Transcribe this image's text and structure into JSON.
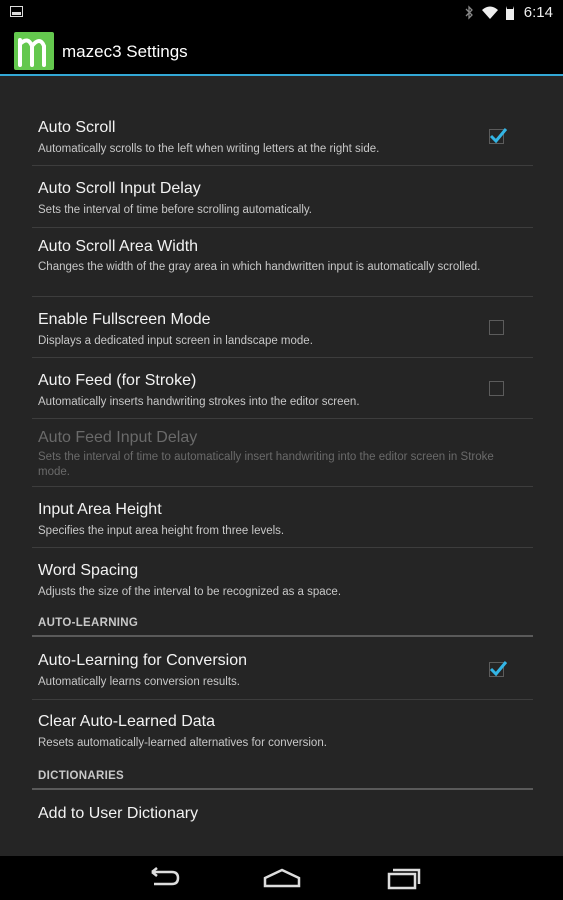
{
  "status_bar": {
    "time": "6:14"
  },
  "action_bar": {
    "title": "mazec3 Settings"
  },
  "items": [
    {
      "title": "Auto Scroll",
      "summary": "Automatically scrolls to the left when writing letters at the right side.",
      "checked": true
    },
    {
      "title": "Auto Scroll Input Delay",
      "summary": "Sets the interval of time before scrolling automatically."
    },
    {
      "title": "Auto Scroll Area Width",
      "summary": "Changes the width of the gray area in which handwritten input is automatically scrolled."
    },
    {
      "title": "Enable Fullscreen Mode",
      "summary": "Displays a dedicated input screen in landscape mode.",
      "checked": false
    },
    {
      "title": "Auto Feed (for Stroke)",
      "summary": "Automatically inserts handwriting strokes into the editor screen.",
      "checked": false
    },
    {
      "title": "Auto Feed Input Delay",
      "summary": "Sets the interval of time to automatically insert handwriting into the editor screen in Stroke mode.",
      "enabled": false
    },
    {
      "title": "Input Area Height",
      "summary": "Specifies the input area height from three levels."
    },
    {
      "title": "Word Spacing",
      "summary": "Adjusts the size of the interval to be recognized as a space."
    }
  ],
  "categories": {
    "auto_learning": "AUTO-LEARNING",
    "dictionaries": "DICTIONARIES"
  },
  "auto_learning_items": [
    {
      "title": "Auto-Learning for Conversion",
      "summary": "Automatically learns conversion results.",
      "checked": true
    },
    {
      "title": "Clear Auto-Learned Data",
      "summary": "Resets automatically-learned alternatives for conversion."
    }
  ],
  "dictionary_items": [
    {
      "title": "Add to User Dictionary"
    }
  ],
  "colors": {
    "accent": "#33a8d6",
    "app_icon": "#64c84e",
    "list_bg": "#252525"
  },
  "icons": [
    "notification-icon",
    "bluetooth-icon",
    "wifi-icon",
    "battery-icon",
    "app-logo-icon",
    "checkmark-icon",
    "back-icon",
    "home-icon",
    "recents-icon"
  ]
}
